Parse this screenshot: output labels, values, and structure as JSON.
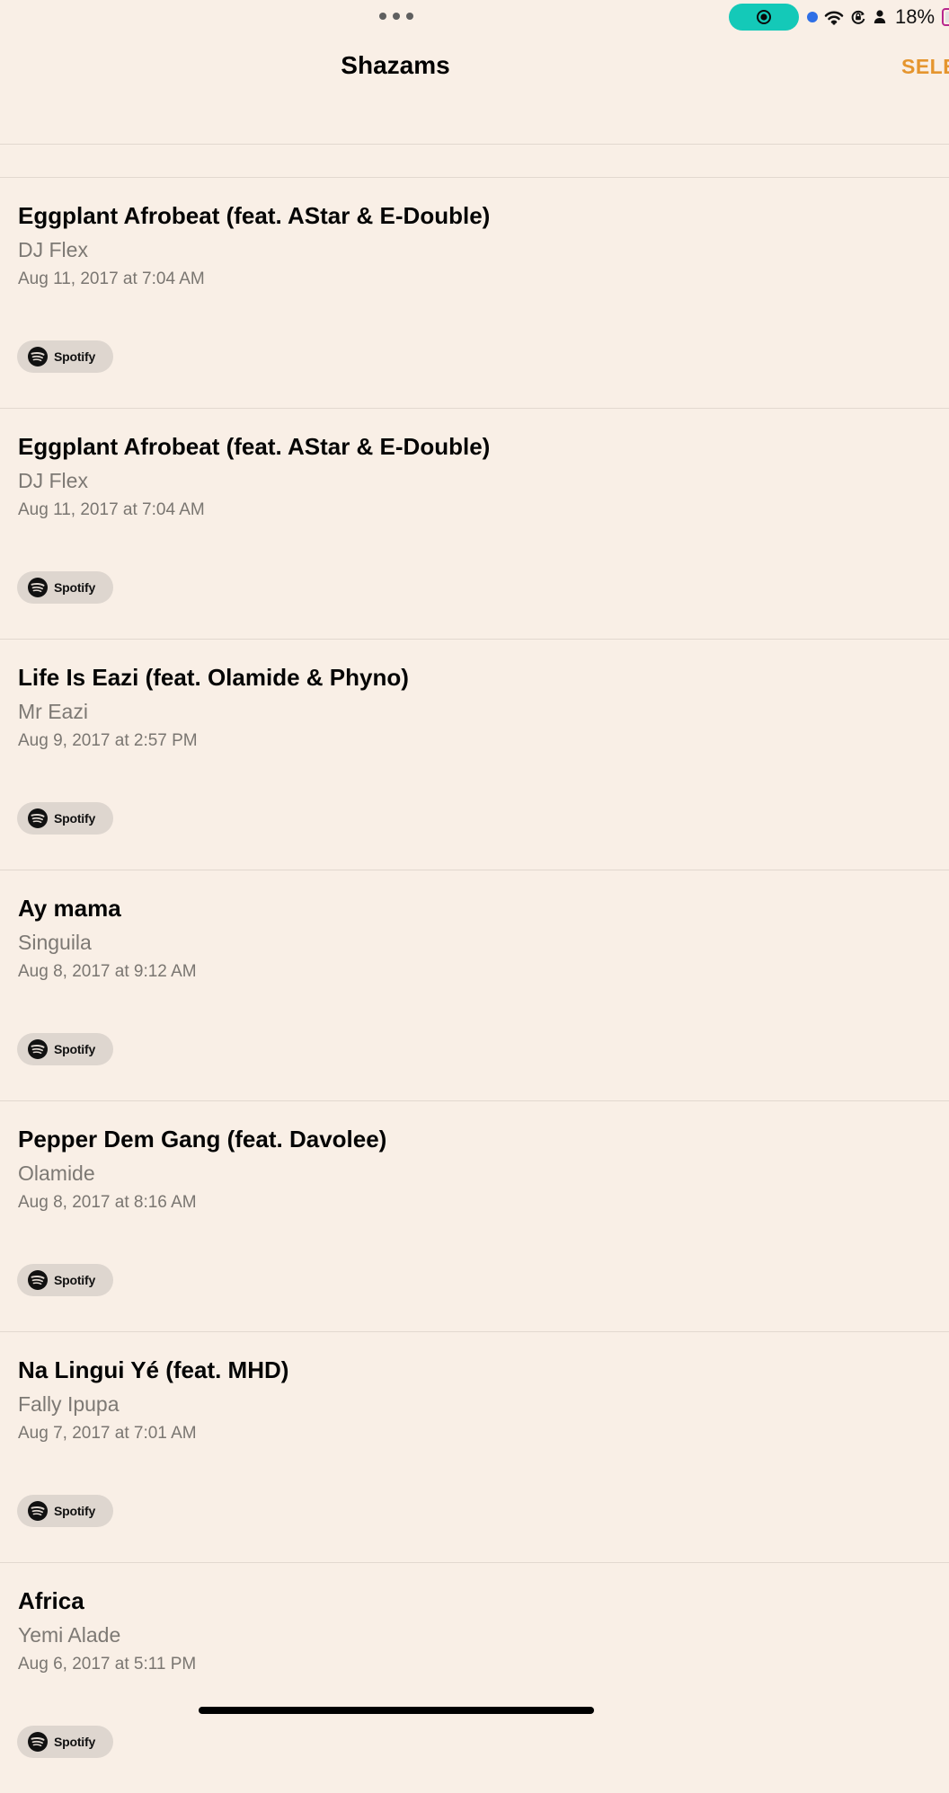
{
  "status_bar": {
    "dots_icon": "more-dots-icon",
    "record_icon": "screen-record-icon",
    "wifi_icon": "wifi-icon",
    "rotation_lock_icon": "rotation-lock-icon",
    "person_icon": "person-icon",
    "battery_percent": "18%",
    "colors": {
      "record_pill": "#14c9b8",
      "blue_dot": "#2e6fe6",
      "battery_outline": "#b8278e"
    }
  },
  "nav": {
    "title": "Shazams",
    "select_label": "SELE",
    "select_color": "#e5952e"
  },
  "list": {
    "items": [
      {
        "title": "Eggplant Afrobeat (feat. AStar & E-Double)",
        "artist": "DJ Flex",
        "date": "Aug 11, 2017 at 7:04 AM",
        "button_label": "Spotify"
      },
      {
        "title": "Eggplant Afrobeat (feat. AStar & E-Double)",
        "artist": "DJ Flex",
        "date": "Aug 11, 2017 at 7:04 AM",
        "button_label": "Spotify"
      },
      {
        "title": "Life Is Eazi (feat. Olamide & Phyno)",
        "artist": "Mr Eazi",
        "date": "Aug 9, 2017 at 2:57 PM",
        "button_label": "Spotify"
      },
      {
        "title": "Ay mama",
        "artist": "Singuila",
        "date": "Aug 8, 2017 at 9:12 AM",
        "button_label": "Spotify"
      },
      {
        "title": "Pepper Dem Gang (feat. Davolee)",
        "artist": "Olamide",
        "date": "Aug 8, 2017 at 8:16 AM",
        "button_label": "Spotify"
      },
      {
        "title": "Na Lingui Yé (feat. MHD)",
        "artist": "Fally Ipupa",
        "date": "Aug 7, 2017 at 7:01 AM",
        "button_label": "Spotify"
      },
      {
        "title": "Africa",
        "artist": "Yemi Alade",
        "date": "Aug 6, 2017 at 5:11 PM",
        "button_label": "Spotify"
      }
    ],
    "spotify_icon": "spotify-icon",
    "background": "#f9efe6"
  }
}
